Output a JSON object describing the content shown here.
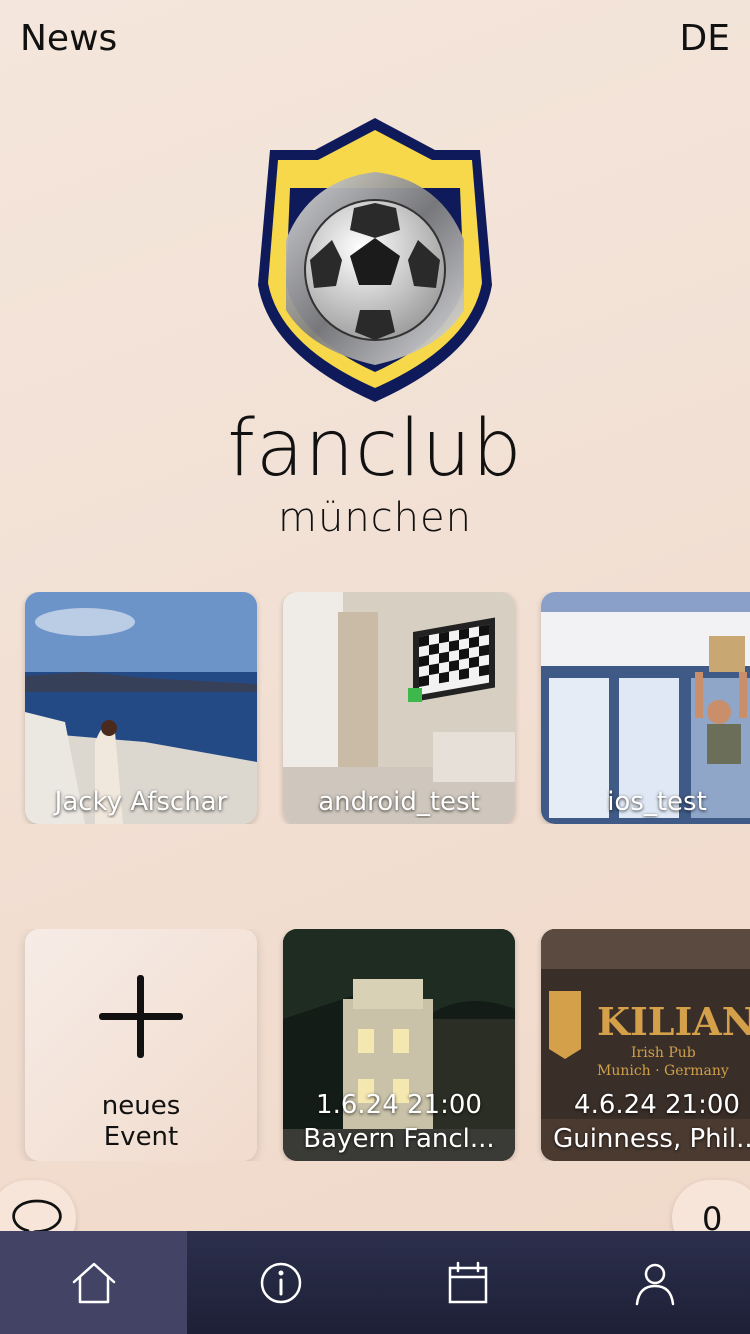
{
  "header": {
    "title": "News",
    "language": "DE"
  },
  "logo": {
    "name": "fanclub",
    "city": "münchen"
  },
  "members": [
    {
      "name": "Jacky Afschar"
    },
    {
      "name": "android_test"
    },
    {
      "name": "ios_test"
    }
  ],
  "events": {
    "new_event_label": "neues\nEvent",
    "items": [
      {
        "datetime": "1.6.24 21:00",
        "title": "Bayern Fancl..."
      },
      {
        "datetime": "4.6.24 21:00",
        "title": "Guinness, Phil..."
      }
    ]
  },
  "fab": {
    "count": "0"
  },
  "tabs": [
    {
      "icon": "home-icon",
      "active": true
    },
    {
      "icon": "info-icon",
      "active": false
    },
    {
      "icon": "calendar-icon",
      "active": false
    },
    {
      "icon": "user-icon",
      "active": false
    }
  ],
  "colors": {
    "accent_tabbar": "#2c2f4c",
    "active_tab": "#434465",
    "badge_yellow": "#f6d84a",
    "badge_navy": "#0e1a5a"
  }
}
